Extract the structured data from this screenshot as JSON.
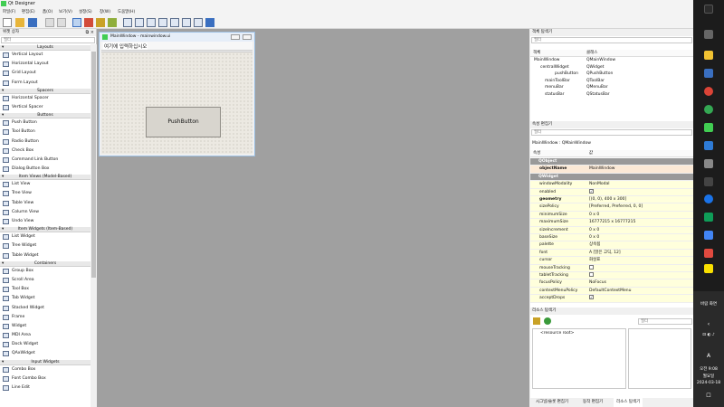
{
  "app": {
    "title": "Qt Designer"
  },
  "menu": [
    "파일(F)",
    "편집(E)",
    "폼(O)",
    "보기(V)",
    "설정(S)",
    "창(W)",
    "도움말(H)"
  ],
  "widget_box": {
    "title": "위젯 상자",
    "filter_placeholder": "필터",
    "sections": [
      {
        "name": "Layouts",
        "items": [
          "Vertical Layout",
          "Horizontal Layout",
          "Grid Layout",
          "Form Layout"
        ]
      },
      {
        "name": "Spacers",
        "items": [
          "Horizontal Spacer",
          "Vertical Spacer"
        ]
      },
      {
        "name": "Buttons",
        "items": [
          "Push Button",
          "Tool Button",
          "Radio Button",
          "Check Box",
          "Command Link Button",
          "Dialog Button Box"
        ]
      },
      {
        "name": "Item Views (Model-Based)",
        "items": [
          "List View",
          "Tree View",
          "Table View",
          "Column View",
          "Undo View"
        ]
      },
      {
        "name": "Item Widgets (Item-Based)",
        "items": [
          "List Widget",
          "Tree Widget",
          "Table Widget"
        ]
      },
      {
        "name": "Containers",
        "items": [
          "Group Box",
          "Scroll Area",
          "Tool Box",
          "Tab Widget",
          "Stacked Widget",
          "Frame",
          "Widget",
          "MDI Area",
          "Dock Widget",
          "QAxWidget"
        ]
      },
      {
        "name": "Input Widgets",
        "items": [
          "Combo Box",
          "Font Combo Box",
          "Line Edit"
        ]
      }
    ]
  },
  "form_window": {
    "title": "MainWindow - mainwindow.ui",
    "menu_placeholder": "여기에 입력하십시오",
    "push_button_label": "PushButton"
  },
  "object_inspector": {
    "title": "객체 탐색기",
    "filter_placeholder": "필터",
    "columns": [
      "객체",
      "클래스"
    ],
    "rows": [
      {
        "object": "MainWindow",
        "class": "QMainWindow"
      },
      {
        "object": "centralWidget",
        "class": "QWidget"
      },
      {
        "object": "pushButton",
        "class": "QPushButton"
      },
      {
        "object": "mainToolBar",
        "class": "QToolBar"
      },
      {
        "object": "menuBar",
        "class": "QMenuBar"
      },
      {
        "object": "statusBar",
        "class": "QStatusBar"
      }
    ]
  },
  "property_editor": {
    "title": "속성 편집기",
    "filter_placeholder": "필터",
    "context": "MainWindow : QMainWindow",
    "columns": [
      "속성",
      "값"
    ],
    "rows": [
      {
        "name": "QObject",
        "value": "",
        "group": true
      },
      {
        "name": "objectName",
        "value": "MainWindow",
        "bold": true
      },
      {
        "name": "QWidget",
        "value": "",
        "group": true
      },
      {
        "name": "windowModality",
        "value": "NonModal"
      },
      {
        "name": "enabled",
        "value": "",
        "check": true
      },
      {
        "name": "geometry",
        "value": "[(0, 0), 400 x 300]",
        "bold": true
      },
      {
        "name": "sizePolicy",
        "value": "[Preferred, Preferred, 0, 0]"
      },
      {
        "name": "minimumSize",
        "value": "0 x 0"
      },
      {
        "name": "maximumSize",
        "value": "16777215 x 16777215"
      },
      {
        "name": "sizeIncrement",
        "value": "0 x 0"
      },
      {
        "name": "baseSize",
        "value": "0 x 0"
      },
      {
        "name": "palette",
        "value": "상속됨"
      },
      {
        "name": "font",
        "value": "A  [맑은 고딕, 12]"
      },
      {
        "name": "cursor",
        "value": "화살표"
      },
      {
        "name": "mouseTracking",
        "value": "",
        "check": false
      },
      {
        "name": "tabletTracking",
        "value": "",
        "check": false
      },
      {
        "name": "focusPolicy",
        "value": "NoFocus"
      },
      {
        "name": "contextMenuPolicy",
        "value": "DefaultContextMenu"
      },
      {
        "name": "acceptDrops",
        "value": "",
        "check": true
      }
    ]
  },
  "resource_browser": {
    "title": "리소스 탐색기",
    "filter_placeholder": "필터",
    "root": "<resource root>"
  },
  "bottom_tabs": [
    "시그널/슬롯 편집기",
    "동작 편집기",
    "리소스 탐색기"
  ],
  "taskbar": {
    "lang": "A",
    "time": "오전 9:08",
    "day": "월요일",
    "date": "2024-03-18",
    "label": "바람 화면"
  },
  "colors": {
    "accent": "#41cd52",
    "panel": "#f0f0f0",
    "mdi": "#a0a0a0",
    "prop_yellow": "#ffffdc",
    "prop_group": "#999999"
  }
}
